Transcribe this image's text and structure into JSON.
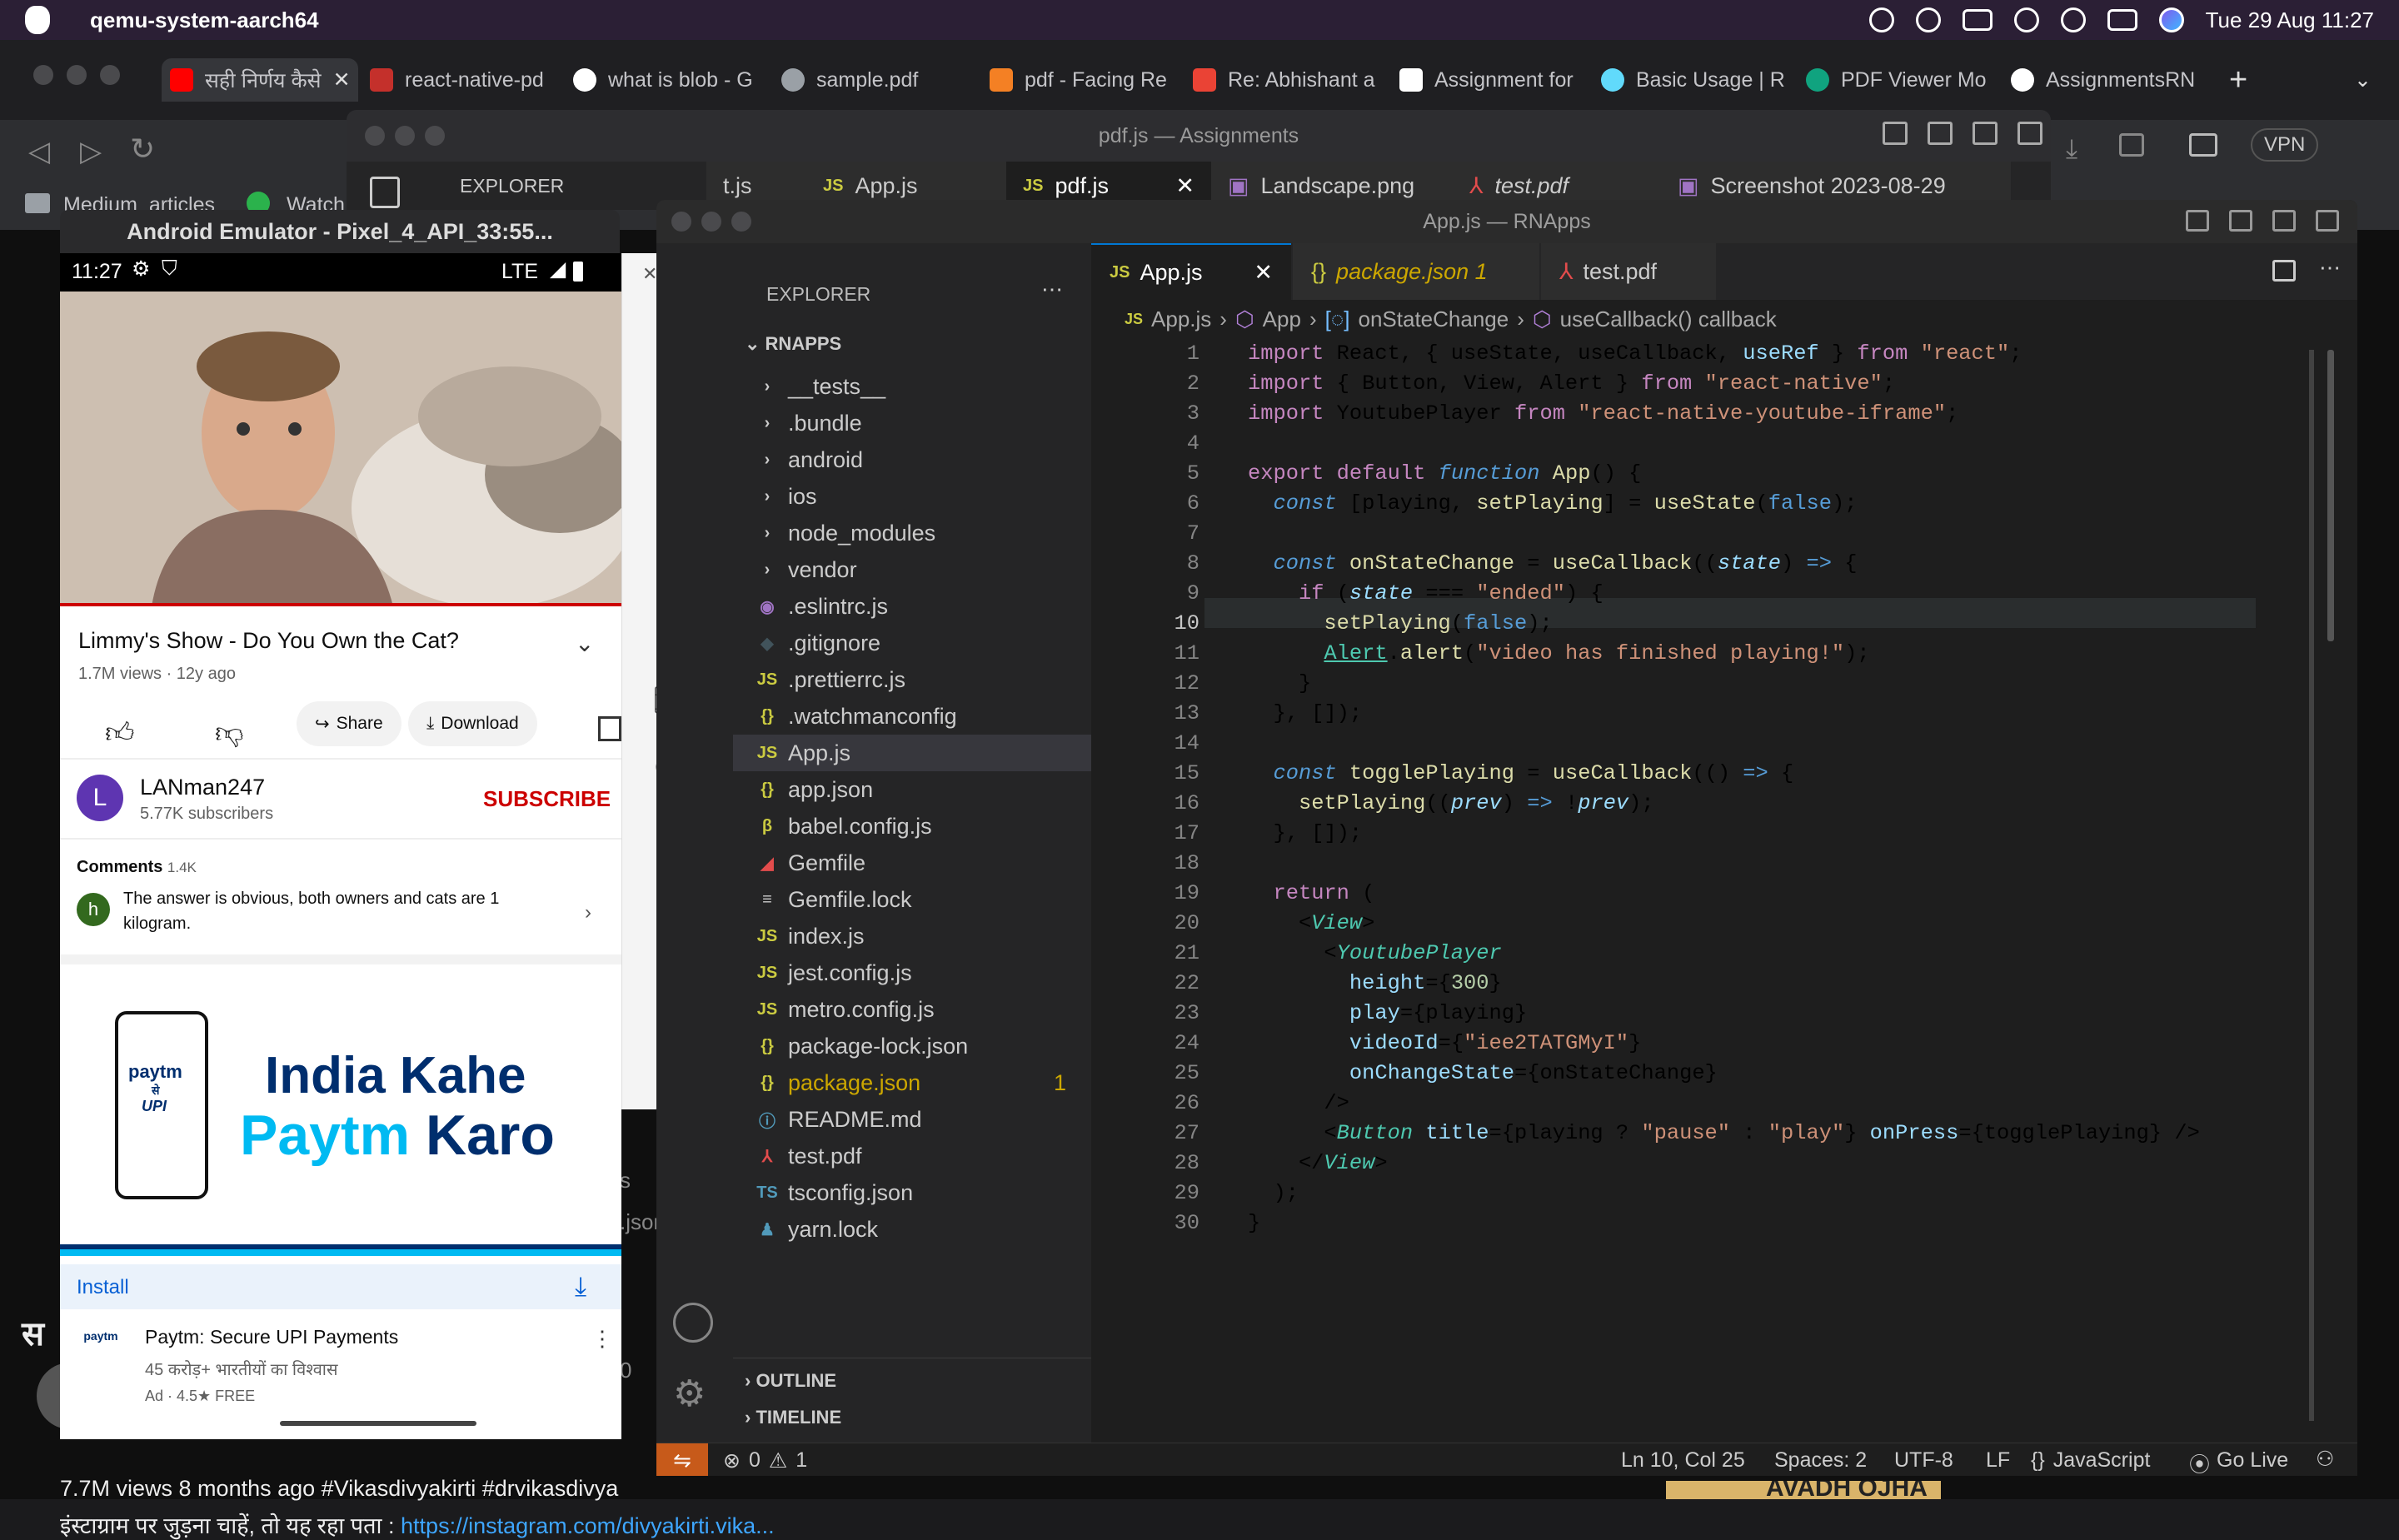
{
  "menubar": {
    "app": "qemu-system-aarch64",
    "datetime": "Tue 29 Aug  11:27"
  },
  "chrome": {
    "tabs": [
      "सही निर्णय कैसे",
      "react-native-pd",
      "what is blob - G",
      "sample.pdf",
      "pdf - Facing Re",
      "Re: Abhishant a",
      "Assignment for",
      "Basic Usage | R",
      "PDF Viewer Mo",
      "AssignmentsRN"
    ],
    "bookmarks": [
      "Medium_articles",
      "Watch"
    ],
    "vpn": "VPN",
    "yt_views": "7.7M views  8 months ago  #Vikasdivyakirti #drvikasdivya",
    "yt_desc": "इंस्टाग्राम पर जुड़ना चाहें, तो यह रहा पता : ",
    "yt_link": "https://instagram.com/divyakirti.vika...",
    "bg_banner": "AVADH OJHA",
    "bg_sa": "स",
    "bg_frag_s": "s",
    "bg_frag_json": ".json",
    "bg_frag_0": "0"
  },
  "pdfwin": {
    "title": "pdf.js — Assignments",
    "explorer": "EXPLORER",
    "tabs": [
      "t.js",
      "App.js",
      "pdf.js",
      "Landscape.png",
      "test.pdf",
      "Screenshot 2023-08-29"
    ]
  },
  "emulator": {
    "title": "Android Emulator - Pixel_4_API_33:55...",
    "time": "11:27",
    "network": "LTE",
    "video_title": "Limmy's Show - Do You Own the Cat?",
    "video_meta": "1.7M views · 12y ago",
    "share": "Share",
    "download": "Download",
    "channel_initial": "L",
    "channel": "LANman247",
    "subs": "5.77K subscribers",
    "subscribe": "SUBSCRIBE",
    "comments_label": "Comments",
    "comments_count": "1.4K",
    "comment_initial": "h",
    "comment_text": "The answer is obvious, both owners and cats are 1 kilogram.",
    "ad_line1": "India Kahe",
    "ad_line2a": "Paytm",
    "ad_line2b": " Karo",
    "ad_phone_logo": "paytm",
    "ad_phone_se": "से",
    "ad_phone_upi": "UPI",
    "install": "Install",
    "app_name": "Paytm: Secure UPI Payments",
    "app_sub": "45 करोड़+ भारतीयों का विश्वास",
    "app_meta": "Ad · 4.5★  FREE"
  },
  "vscode": {
    "title": "App.js — RNApps",
    "explorer": "EXPLORER",
    "project": "RNAPPS",
    "files": [
      {
        "name": "__tests__",
        "icon": "›",
        "color": "#cccccc"
      },
      {
        "name": ".bundle",
        "icon": "›",
        "color": "#cccccc"
      },
      {
        "name": "android",
        "icon": "›",
        "color": "#cccccc"
      },
      {
        "name": "ios",
        "icon": "›",
        "color": "#cccccc"
      },
      {
        "name": "node_modules",
        "icon": "›",
        "color": "#cccccc"
      },
      {
        "name": "vendor",
        "icon": "›",
        "color": "#cccccc"
      },
      {
        "name": ".eslintrc.js",
        "icon": "◉",
        "color": "#a074c4"
      },
      {
        "name": ".gitignore",
        "icon": "◆",
        "color": "#41535b"
      },
      {
        "name": ".prettierrc.js",
        "icon": "JS",
        "color": "#cbcb41"
      },
      {
        "name": ".watchmanconfig",
        "icon": "{}",
        "color": "#cbcb41"
      },
      {
        "name": "App.js",
        "icon": "JS",
        "color": "#cbcb41"
      },
      {
        "name": "app.json",
        "icon": "{}",
        "color": "#cbcb41"
      },
      {
        "name": "babel.config.js",
        "icon": "β",
        "color": "#cbcb41"
      },
      {
        "name": "Gemfile",
        "icon": "◢",
        "color": "#e34c4c"
      },
      {
        "name": "Gemfile.lock",
        "icon": "≡",
        "color": "#cccccc"
      },
      {
        "name": "index.js",
        "icon": "JS",
        "color": "#cbcb41"
      },
      {
        "name": "jest.config.js",
        "icon": "JS",
        "color": "#cbcb41"
      },
      {
        "name": "metro.config.js",
        "icon": "JS",
        "color": "#cbcb41"
      },
      {
        "name": "package-lock.json",
        "icon": "{}",
        "color": "#cbcb41"
      },
      {
        "name": "package.json",
        "icon": "{}",
        "color": "#cbcb41"
      },
      {
        "name": "README.md",
        "icon": "ⓘ",
        "color": "#519aba"
      },
      {
        "name": "test.pdf",
        "icon": "⅄",
        "color": "#e34c4c"
      },
      {
        "name": "tsconfig.json",
        "icon": "TS",
        "color": "#519aba"
      },
      {
        "name": "yarn.lock",
        "icon": "♟",
        "color": "#519aba"
      }
    ],
    "pkg_badge": "1",
    "outline": "OUTLINE",
    "timeline": "TIMELINE",
    "tabs": [
      {
        "label": "App.js",
        "icon": "JS"
      },
      {
        "label": "package.json 1",
        "icon": "{}"
      },
      {
        "label": "test.pdf",
        "icon": "⅄"
      }
    ],
    "breadcrumb": [
      "App.js",
      "App",
      "onStateChange",
      "useCallback() callback"
    ],
    "status": {
      "errors": "0",
      "warnings": "1",
      "position": "Ln 10, Col 25",
      "spaces": "Spaces: 2",
      "encoding": "UTF-8",
      "eol": "LF",
      "language": "JavaScript",
      "golive": "Go Live"
    },
    "colors": {
      "keyword": "#c586c0",
      "string": "#ce9178",
      "function": "#dcdcaa",
      "variable": "#9cdcfe",
      "component": "#4ec9b0",
      "plain": "#d4d4d4"
    }
  }
}
